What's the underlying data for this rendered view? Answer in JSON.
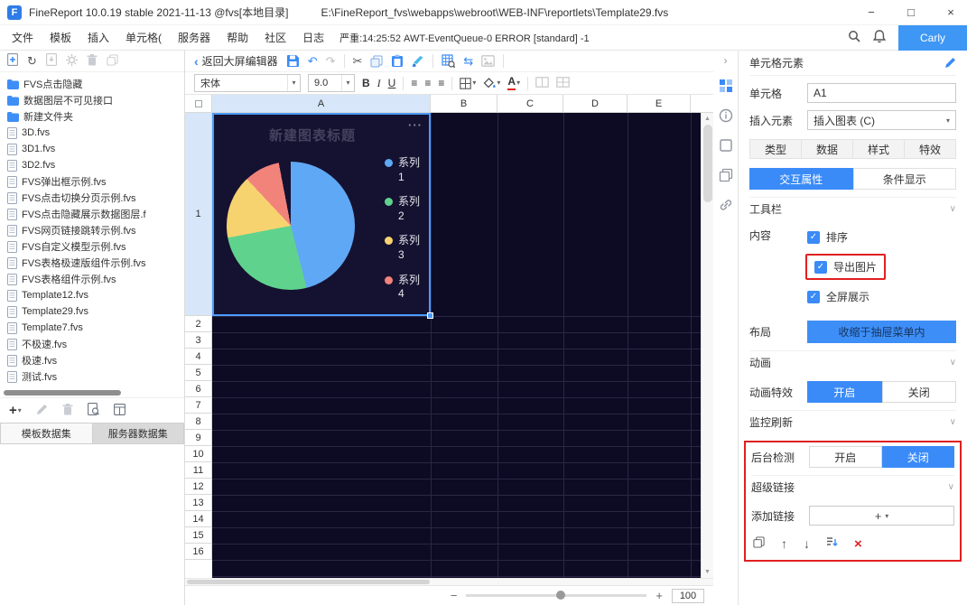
{
  "colors": {
    "accent_blue": "#3A8BF7",
    "user_badge": "#3E97F5",
    "grid_bg": "#0D0A23",
    "grid_line": "#2A2745",
    "chart_bg": "#151231",
    "selection_blue": "#4C9BFF",
    "annotation_red": "#E02020",
    "selected_header_bg": "#D7E7F9"
  },
  "icons": {
    "minimize": "−",
    "maximize": "□",
    "close": "×",
    "back_chevron": "‹",
    "collapse_chevron": "›",
    "section_chevron": "∨",
    "caret_down": "▾",
    "undo": "↶",
    "redo": "↷",
    "cut": "✂",
    "swap": "⇆",
    "refresh": "↻",
    "plus": "+",
    "minus": "−",
    "arrow_up": "↑",
    "arrow_down": "↓",
    "delete_x": "×",
    "check": "✓",
    "align": "≡",
    "dots": "···",
    "scroll_up": "▲",
    "scroll_down": "▼"
  },
  "title_bar": {
    "logo": "F",
    "title": "FineReport 10.0.19 stable 2021-11-13 @fvs[本地目录]",
    "path": "E:\\FineReport_fvs\\webapps\\webroot\\WEB-INF\\reportlets\\Template29.fvs"
  },
  "menu_bar": {
    "items": [
      "文件",
      "模板",
      "插入",
      "单元格(",
      "服务器",
      "帮助",
      "社区",
      "日志"
    ],
    "log": "严重:14:25:52 AWT-EventQueue-0 ERROR [standard] -1",
    "user": "Carly"
  },
  "toolbar": {
    "back_label": "返回大屏编辑器"
  },
  "format_bar": {
    "font": "宋体",
    "size": "9.0",
    "bold": "B",
    "italic": "I",
    "underline": "U",
    "font_color": "A"
  },
  "sidebar": {
    "folders": [
      "FVS点击隐藏",
      "数据图层不可见接口",
      "新建文件夹"
    ],
    "files": [
      "3D.fvs",
      "3D1.fvs",
      "3D2.fvs",
      "FVS弹出框示例.fvs",
      "FVS点击切换分页示例.fvs",
      "FVS点击隐藏展示数据图层.f",
      "FVS网页链接跳转示例.fvs",
      "FVS自定义模型示例.fvs",
      "FVS表格极速版组件示例.fvs",
      "FVS表格组件示例.fvs",
      "Template12.fvs",
      "Template29.fvs",
      "Template7.fvs",
      "不极速.fvs",
      "极速.fvs",
      "测试.fvs"
    ],
    "tabs": [
      "模板数据集",
      "服务器数据集"
    ]
  },
  "grid": {
    "col_headers": [
      "A",
      "B",
      "C",
      "D",
      "E"
    ],
    "rows": [
      "1",
      "2",
      "3",
      "4",
      "5",
      "6",
      "7",
      "8",
      "9",
      "10",
      "11",
      "12",
      "13",
      "14",
      "15",
      "16"
    ],
    "selected_cell": "A1",
    "zoom": "100"
  },
  "chart": {
    "title": "新建图表标题",
    "menu": "···",
    "chart_data": {
      "type": "pie",
      "title": "新建图表标题",
      "legend_position": "right",
      "slices": [
        {
          "name": "系列1",
          "value": 46,
          "color": "#5FA8F5"
        },
        {
          "name": "系列2",
          "value": 26,
          "color": "#5FD38D"
        },
        {
          "name": "系列3",
          "value": 16,
          "color": "#F7D36F"
        },
        {
          "name": "系列4",
          "value": 9,
          "color": "#F2837B"
        }
      ]
    }
  },
  "right_panel": {
    "header": "单元格元素",
    "cell_label": "单元格",
    "cell_value": "A1",
    "insert_label": "插入元素",
    "insert_value": "插入图表 (C)",
    "tabs": [
      "类型",
      "数据",
      "样式",
      "特效"
    ],
    "subtabs": [
      "交互属性",
      "条件显示"
    ],
    "active_subtab": "交互属性",
    "toolbar_section": {
      "title": "工具栏",
      "content_label": "内容",
      "checkboxes": [
        {
          "label": "排序",
          "checked": true,
          "highlighted": false
        },
        {
          "label": "导出图片",
          "checked": true,
          "highlighted": true
        },
        {
          "label": "全屏展示",
          "checked": true,
          "highlighted": false
        }
      ],
      "layout_label": "布局",
      "layout_button": "收缩于抽屉菜单内"
    },
    "animation_section": {
      "title": "动画",
      "label": "动画特效",
      "options": [
        "开启",
        "关闭"
      ],
      "active": "开启"
    },
    "monitor_section": {
      "title": "监控刷新",
      "label": "后台检测",
      "options": [
        "开启",
        "关闭"
      ],
      "active": "关闭"
    },
    "link_section": {
      "title": "超级链接",
      "add_label": "添加链接"
    }
  }
}
